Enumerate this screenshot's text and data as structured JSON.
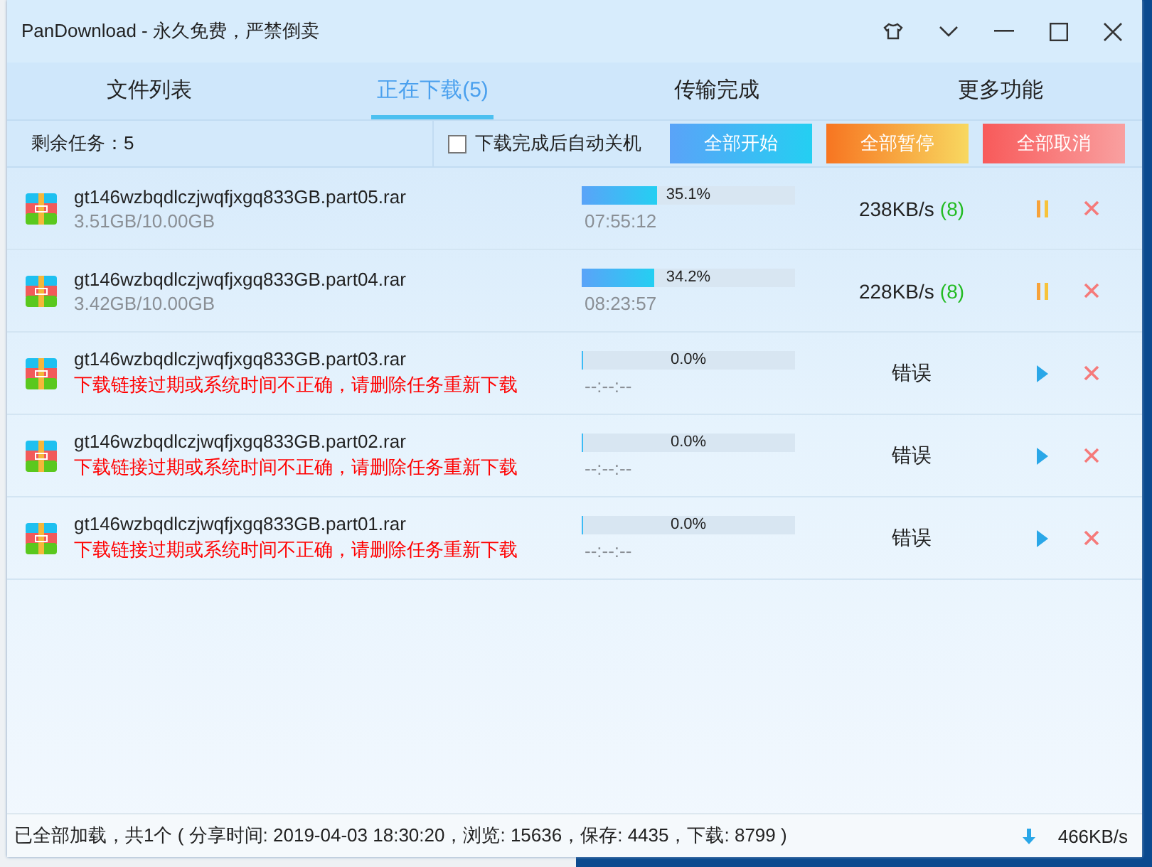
{
  "window": {
    "title": "PanDownload - 永久免费，严禁倒卖"
  },
  "tabs": [
    {
      "label": "文件列表",
      "selected": false
    },
    {
      "label": "正在下载(5)",
      "selected": true
    },
    {
      "label": "传输完成",
      "selected": false
    },
    {
      "label": "更多功能",
      "selected": false
    }
  ],
  "toolbar": {
    "remaining": "剩余任务：5",
    "auto_shutdown": {
      "label": "下载完成后自动关机",
      "checked": false
    },
    "buttons": [
      {
        "label": "全部开始",
        "kind": "start"
      },
      {
        "label": "全部暂停",
        "kind": "pause"
      },
      {
        "label": "全部取消",
        "kind": "cancel"
      }
    ]
  },
  "downloads": [
    {
      "name": "gt146wzbqdlczjwqfjxgq833GB.part05.rar",
      "kind": "downloading",
      "detail": "3.51GB/10.00GB",
      "level": 0.351,
      "percent": "35.1%",
      "time": "07:55:12",
      "speed": "238KB/s",
      "connections": "(8)"
    },
    {
      "name": "gt146wzbqdlczjwqfjxgq833GB.part04.rar",
      "kind": "downloading",
      "detail": "3.42GB/10.00GB",
      "level": 0.342,
      "percent": "34.2%",
      "time": "08:23:57",
      "speed": "228KB/s",
      "connections": "(8)"
    },
    {
      "name": "gt146wzbqdlczjwqfjxgq833GB.part03.rar",
      "kind": "error",
      "detail": "下载链接过期或系统时间不正确，请删除任务重新下载",
      "level": 0,
      "percent": "0.0%",
      "time": "--:--:--",
      "speed": "错误"
    },
    {
      "name": "gt146wzbqdlczjwqfjxgq833GB.part02.rar",
      "kind": "error",
      "detail": "下载链接过期或系统时间不正确，请删除任务重新下载",
      "level": 0,
      "percent": "0.0%",
      "time": "--:--:--",
      "speed": "错误"
    },
    {
      "name": "gt146wzbqdlczjwqfjxgq833GB.part01.rar",
      "kind": "error",
      "detail": "下载链接过期或系统时间不正确，请删除任务重新下载",
      "level": 0,
      "percent": "0.0%",
      "time": "--:--:--",
      "speed": "错误"
    }
  ],
  "status_bar": {
    "text": "已全部加载，共1个 ( 分享时间: 2019-04-03 18:30:20，浏览: 15636，保存: 4435，下载: 8799 )",
    "speed": "466KB/s"
  }
}
